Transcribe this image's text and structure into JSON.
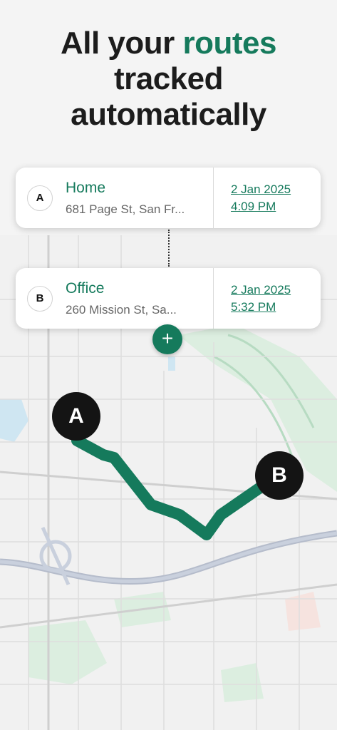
{
  "headline": {
    "line1_prefix": "All your ",
    "line1_accent": "routes",
    "line2": "tracked",
    "line3": "automatically"
  },
  "stops": [
    {
      "badge": "A",
      "place": "Home",
      "address": "681 Page St, San Fr...",
      "date": "2 Jan 2025",
      "time": "4:09 PM"
    },
    {
      "badge": "B",
      "place": "Office",
      "address": "260 Mission St, Sa...",
      "date": "2 Jan 2025",
      "time": "5:32 PM"
    }
  ],
  "add_button": {
    "icon": "plus-icon",
    "glyph": "+"
  },
  "map": {
    "route_color": "#157a5c",
    "pin_a": "A",
    "pin_b": "B"
  },
  "colors": {
    "accent": "#157a5c",
    "text": "#1c1c1c"
  }
}
